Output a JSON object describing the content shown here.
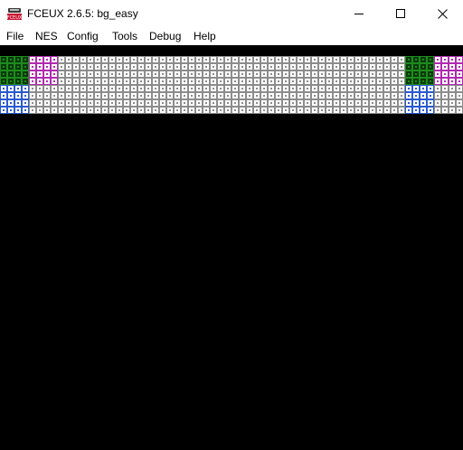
{
  "window": {
    "title": "FCEUX 2.6.5: bg_easy",
    "icon": "fceux-app-icon",
    "controls": [
      "minimize-icon",
      "maximize-icon",
      "close-icon"
    ]
  },
  "menu": {
    "items": [
      {
        "label": "File"
      },
      {
        "label": "NES"
      },
      {
        "label": "Config"
      },
      {
        "label": "Tools"
      },
      {
        "label": "Debug"
      },
      {
        "label": "Help"
      }
    ]
  },
  "game_screen": {
    "background": "#000000",
    "tile_colors": {
      "G": {
        "fill": "#1e8a1e",
        "dot": "#0a3a0a"
      },
      "M": {
        "fill": "#b02ab0",
        "dot": "#ffffff"
      },
      "B": {
        "fill": "#2a5ad0",
        "dot": "#ffffff"
      },
      "W": {
        "fill": "#8c8c8c",
        "dot": "#ffffff"
      }
    },
    "tile_rows": [
      "GGMMWWWWWWWWWWWWWWWWWWWWWWWWGGMM",
      "GGMMWWWWWWWWWWWWWWWWWWWWWWWWGGMM",
      "BBWWWWWWWWWWWWWWWWWWWWWWWWWWBBWW",
      "BBWWWWWWWWWWWWWWWWWWWWWWWWWWBBWW"
    ]
  }
}
